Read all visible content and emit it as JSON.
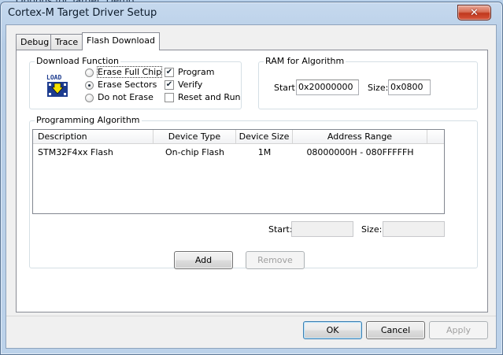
{
  "parent_window": {
    "title": "Options for Target 'Demo'"
  },
  "dialog": {
    "title": "Cortex-M Target Driver Setup",
    "close_glyph": "✕"
  },
  "tabs": [
    {
      "label": "Debug",
      "active": false
    },
    {
      "label": "Trace",
      "active": false
    },
    {
      "label": "Flash Download",
      "active": true
    }
  ],
  "download_function": {
    "group_label": "Download Function",
    "icon": {
      "name": "load-flash-icon",
      "text": "LOAD"
    },
    "erase_options": [
      {
        "label": "Erase Full Chip",
        "selected": false
      },
      {
        "label": "Erase Sectors",
        "selected": true
      },
      {
        "label": "Do not Erase",
        "selected": false
      }
    ],
    "checkboxes": [
      {
        "label": "Program",
        "checked": true
      },
      {
        "label": "Verify",
        "checked": true
      },
      {
        "label": "Reset and Run",
        "checked": false
      }
    ]
  },
  "ram_for_algorithm": {
    "group_label": "RAM for Algorithm",
    "start_label": "Start:",
    "start_value": "0x20000000",
    "size_label": "Size:",
    "size_value": "0x0800"
  },
  "programming_algorithm": {
    "group_label": "Programming Algorithm",
    "columns": [
      "Description",
      "Device Type",
      "Device Size",
      "Address Range"
    ],
    "rows": [
      {
        "description": "STM32F4xx Flash",
        "device_type": "On-chip Flash",
        "device_size": "1M",
        "address_range": "08000000H - 080FFFFFH"
      }
    ],
    "start_label": "Start:",
    "start_value": "",
    "size_label": "Size:",
    "size_value": ""
  },
  "actions": {
    "add": "Add",
    "remove": "Remove"
  },
  "footer": {
    "ok": "OK",
    "cancel": "Cancel",
    "apply": "Apply"
  },
  "colors": {
    "accent": "#3c7fb1",
    "close_red": "#c0381d",
    "icon_blue": "#1d3c8f",
    "icon_yellow": "#f5e100"
  }
}
